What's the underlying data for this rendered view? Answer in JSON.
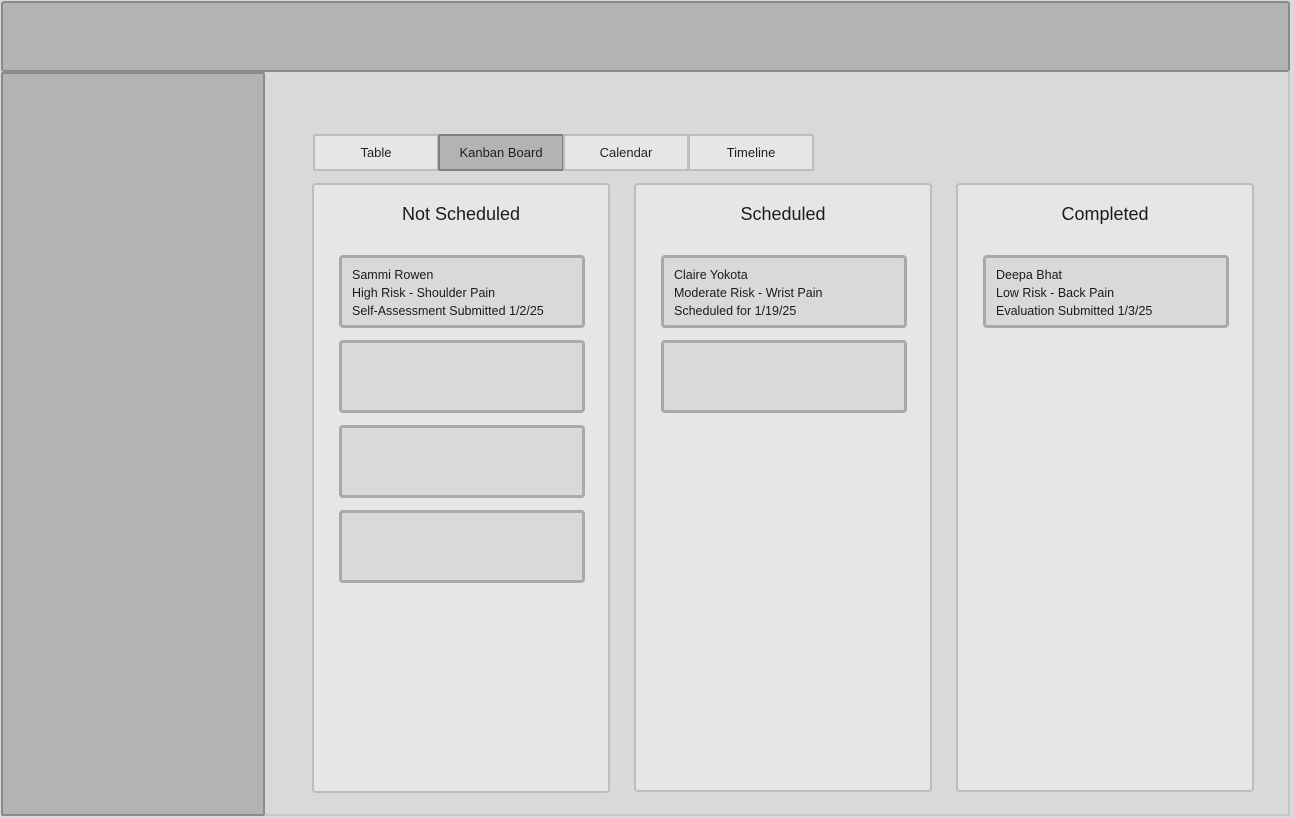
{
  "tabs": [
    {
      "label": "Table"
    },
    {
      "label": "Kanban Board"
    },
    {
      "label": "Calendar"
    },
    {
      "label": "Timeline"
    }
  ],
  "active_tab": "Kanban Board",
  "columns": [
    {
      "title": "Not Scheduled",
      "cards": [
        {
          "name": "Sammi Rowen",
          "risk": "High Risk - Shoulder Pain",
          "status": "Self-Assessment Submitted 1/2/25"
        },
        {
          "name": "",
          "risk": "",
          "status": ""
        },
        {
          "name": "",
          "risk": "",
          "status": ""
        },
        {
          "name": "",
          "risk": "",
          "status": ""
        }
      ]
    },
    {
      "title": "Scheduled",
      "cards": [
        {
          "name": "Claire Yokota",
          "risk": "Moderate Risk - Wrist Pain",
          "status": "Scheduled for 1/19/25"
        },
        {
          "name": "",
          "risk": "",
          "status": ""
        }
      ]
    },
    {
      "title": "Completed",
      "cards": [
        {
          "name": "Deepa Bhat",
          "risk": "Low Risk - Back Pain",
          "status": "Evaluation Submitted 1/3/25"
        }
      ]
    }
  ]
}
